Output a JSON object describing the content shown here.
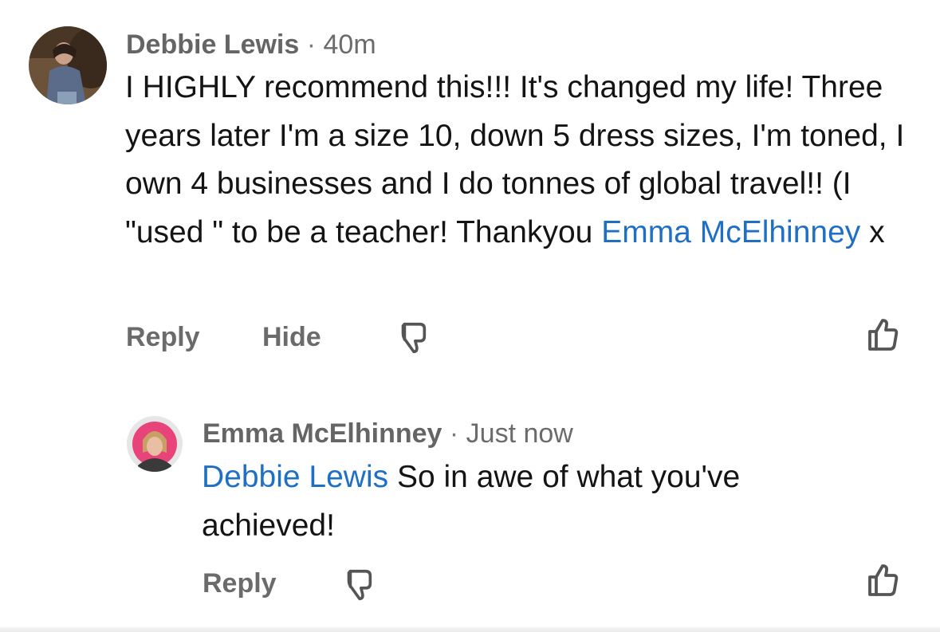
{
  "comments": [
    {
      "author": "Debbie Lewis",
      "separator": "·",
      "time": "40m",
      "text_parts": [
        "I HIGHLY recommend this!!! It's changed my life! Three years later I'm a size 10, down 5 dress sizes, I'm toned, I own 4 businesses and I do tonnes of global travel!! (I \"used \" to be a teacher! Thankyou ",
        "Emma McElhinney",
        " x"
      ],
      "actions": {
        "reply": "Reply",
        "hide": "Hide"
      },
      "icons": {
        "dislike": "thumbs-down-icon",
        "like": "thumbs-up-icon"
      }
    },
    {
      "author": "Emma McElhinney",
      "separator": "·",
      "time": "Just now",
      "text_parts": [
        "Debbie Lewis",
        " So in awe of what you've achieved!"
      ],
      "actions": {
        "reply": "Reply"
      },
      "icons": {
        "dislike": "thumbs-down-icon",
        "like": "thumbs-up-icon"
      }
    }
  ],
  "colors": {
    "mention": "#1f6fc5",
    "meta": "#6b6b6b",
    "body": "#141414"
  }
}
